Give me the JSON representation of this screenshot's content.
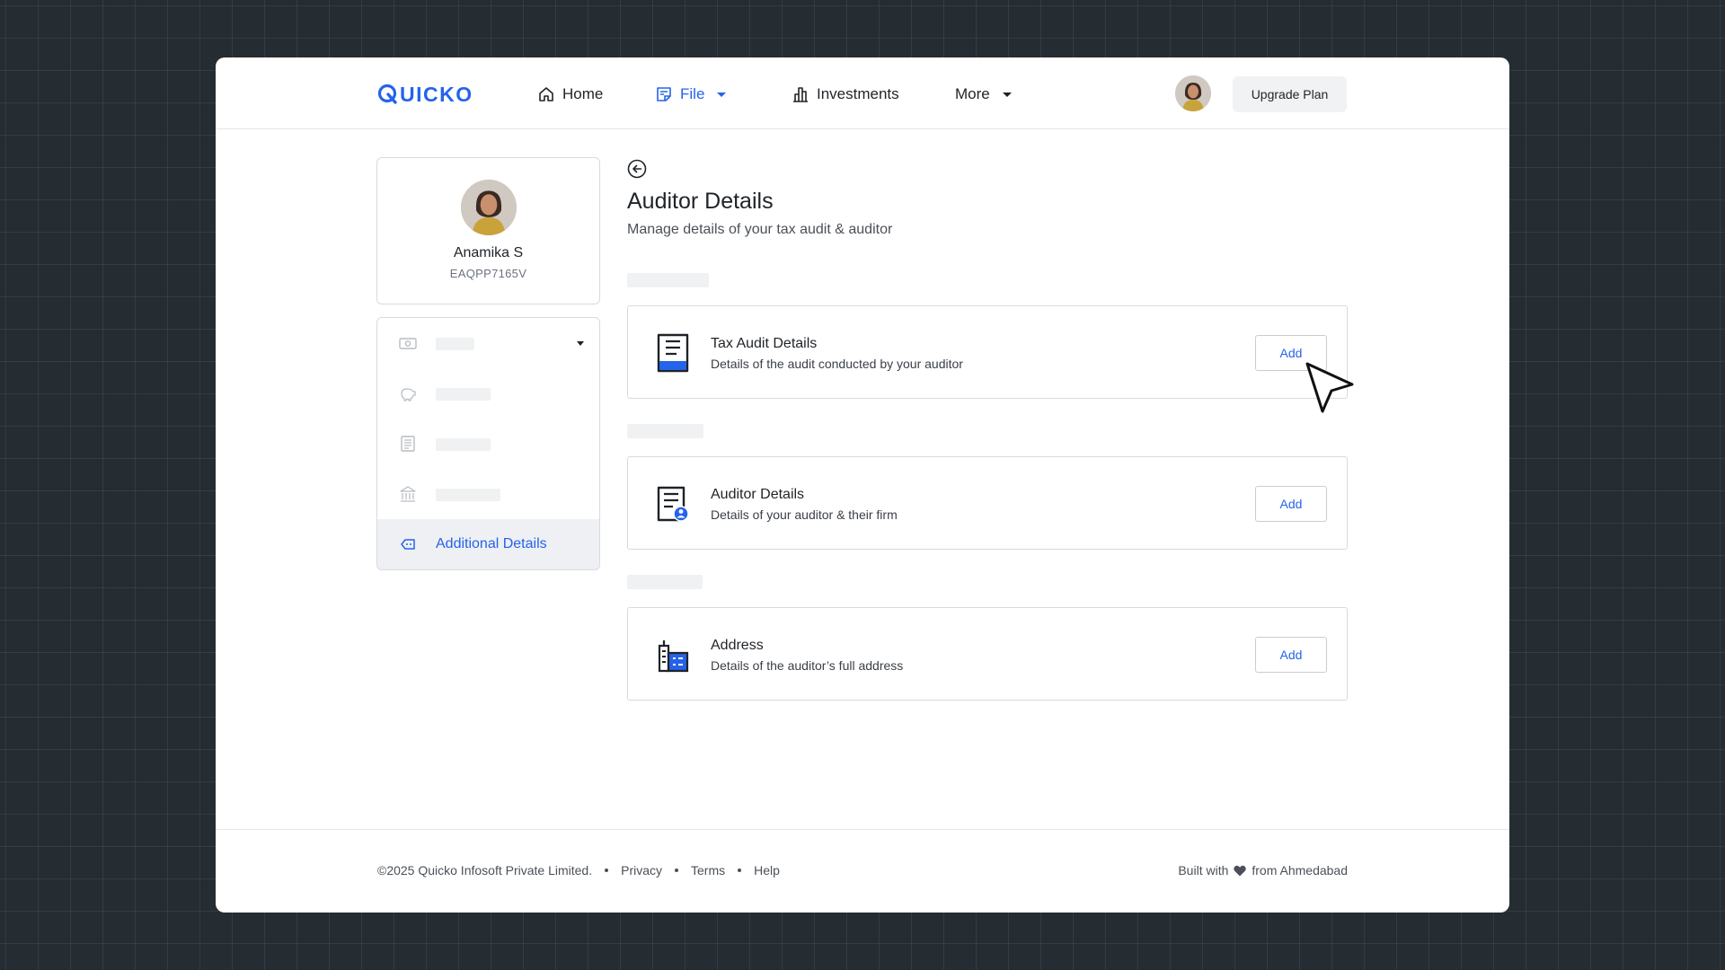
{
  "brand": {
    "logo_text": "QUICKO",
    "accent": "#2563eb"
  },
  "nav": {
    "home": "Home",
    "file": "File",
    "investments": "Investments",
    "more": "More"
  },
  "header": {
    "upgrade_label": "Upgrade Plan",
    "avatar_icon": "user-avatar"
  },
  "profile": {
    "name": "Anamika S",
    "pan": "EAQPP7165V"
  },
  "sidebar": {
    "items": [
      {
        "icon": "money-icon",
        "placeholder": true,
        "expandable": true
      },
      {
        "icon": "piggy-bank-icon",
        "placeholder": true
      },
      {
        "icon": "document-list-icon",
        "placeholder": true
      },
      {
        "icon": "bank-icon",
        "placeholder": true
      },
      {
        "icon": "tag-icon",
        "label": "Additional Details",
        "active": true
      }
    ]
  },
  "main": {
    "title": "Auditor Details",
    "subtitle": "Manage details of your tax audit & auditor",
    "sections": [
      {
        "title": "Tax Audit Details",
        "description": "Details of the audit conducted by your auditor",
        "action": "Add",
        "icon": "audit-document-icon"
      },
      {
        "title": "Auditor Details",
        "description": "Details of your auditor & their firm",
        "action": "Add",
        "icon": "auditor-document-icon"
      },
      {
        "title": "Address",
        "description": "Details of the auditor’s full address",
        "action": "Add",
        "icon": "building-icon"
      }
    ]
  },
  "footer": {
    "copyright": "©2025 Quicko Infosoft Private Limited.",
    "links": [
      "Privacy",
      "Terms",
      "Help"
    ],
    "built_with": "Built with",
    "from": "from Ahmedabad"
  }
}
